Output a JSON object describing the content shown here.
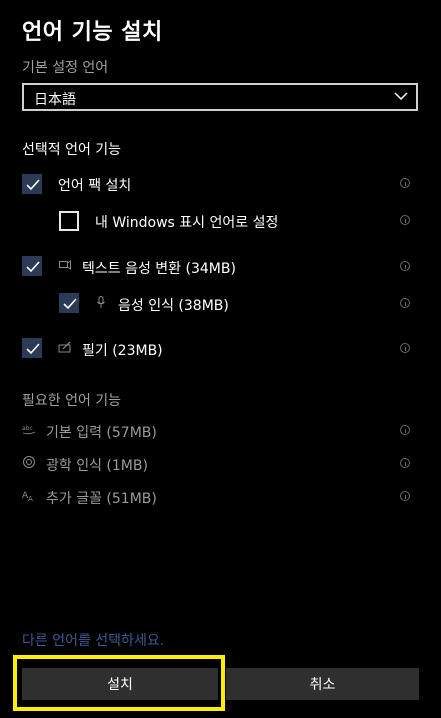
{
  "window": {
    "title": "언어 기능 설치"
  },
  "preferred": {
    "label": "기본 설정 언어",
    "selected": "日本語"
  },
  "optional": {
    "heading": "선택적 언어 기능",
    "items": [
      {
        "label": "언어 팩 설치",
        "checked": true
      },
      {
        "label": "내 Windows 표시 언어로 설정",
        "checked": false
      },
      {
        "label": "텍스트 음성 변환 (34MB)",
        "checked": true
      },
      {
        "label": "음성 인식 (38MB)",
        "checked": true
      },
      {
        "label": "필기 (23MB)",
        "checked": true
      }
    ]
  },
  "required": {
    "heading": "필요한 언어 기능",
    "items": [
      {
        "label": "기본 입력 (57MB)",
        "icon": "abc-icon"
      },
      {
        "label": "광학 인식 (1MB)",
        "icon": "ocr-icon"
      },
      {
        "label": "추가 글꼴 (51MB)",
        "icon": "font-icon"
      }
    ]
  },
  "footer": {
    "link": "다른 언어를 선택하세요.",
    "install": "설치",
    "cancel": "취소"
  },
  "colors": {
    "background": "#000000",
    "checkbox_fill": "#2b3a55",
    "link": "#3c5a8e",
    "button": "#2f2f2f",
    "highlight": "#ffee00"
  }
}
